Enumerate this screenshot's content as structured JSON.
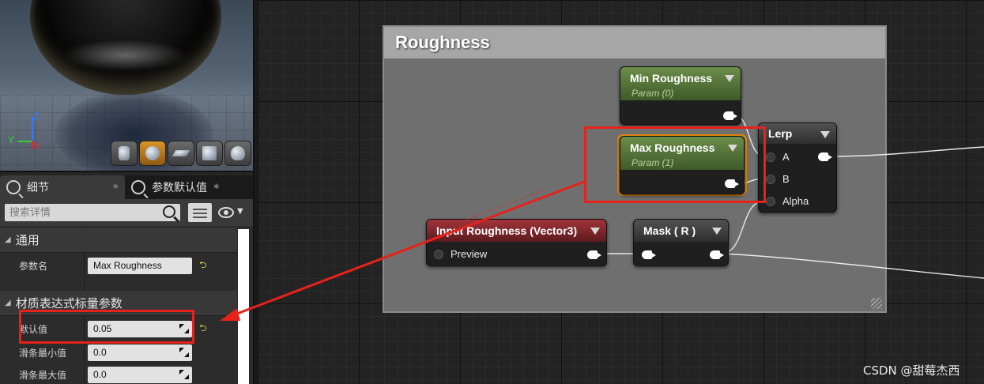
{
  "viewport": {
    "axes": {
      "z": "Z",
      "y": "Y",
      "x": "X"
    },
    "preview_shapes": [
      "cylinder-icon",
      "sphere-icon",
      "plane-icon",
      "cube-icon",
      "teapot-icon"
    ],
    "active_shape": "sphere-icon"
  },
  "tabs": [
    {
      "label": "细节",
      "active": true
    },
    {
      "label": "参数默认值",
      "active": false
    }
  ],
  "search": {
    "placeholder": "搜索详情"
  },
  "details": {
    "general": {
      "title": "通用",
      "param_name_label": "参数名",
      "param_name_value": "Max Roughness"
    },
    "scalar": {
      "title": "材质表达式标量参数",
      "default_label": "默认值",
      "default_value": "0.05",
      "slider_min_label": "滑条最小值",
      "slider_min_value": "0.0",
      "slider_max_label": "滑条最大值",
      "slider_max_value": "0.0"
    }
  },
  "graph": {
    "comment_title": "Roughness",
    "nodes": {
      "min_roughness": {
        "title": "Min Roughness",
        "subtitle": "Param (0)"
      },
      "max_roughness": {
        "title": "Max Roughness",
        "subtitle": "Param (1)"
      },
      "lerp": {
        "title": "Lerp",
        "pins": [
          "A",
          "B",
          "Alpha"
        ]
      },
      "input_roughness": {
        "title": "Input Roughness (Vector3)",
        "pin": "Preview"
      },
      "mask": {
        "title": "Mask ( R )"
      }
    }
  },
  "colors": {
    "highlight": "#e6221a",
    "selection": "#e48a00",
    "param_node": "#4d6e35",
    "function_input_node": "#8c2a30"
  },
  "watermark": "CSDN @甜莓杰西"
}
